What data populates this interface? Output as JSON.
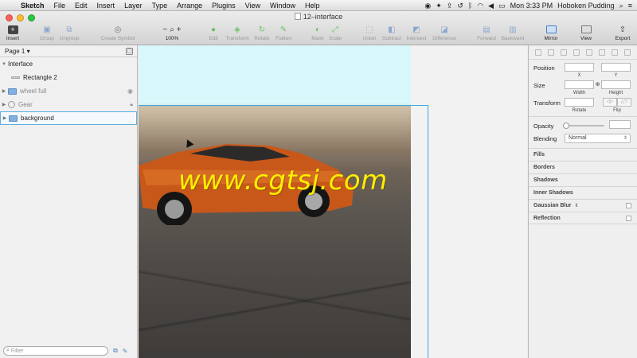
{
  "menubar": {
    "app_name": "Sketch",
    "menus": [
      "File",
      "Edit",
      "Insert",
      "Layer",
      "Type",
      "Arrange",
      "Plugins",
      "View",
      "Window",
      "Help"
    ],
    "clock": "Mon 3:33 PM",
    "user": "Hoboken Pudding"
  },
  "window": {
    "title": "12–interface"
  },
  "toolbar": {
    "insert": "Insert",
    "group": "Group",
    "ungroup": "Ungroup",
    "create_symbol": "Create Symbol",
    "zoom_minus": "−",
    "zoom_plus": "+",
    "zoom_level": "100%",
    "edit": "Edit",
    "transform": "Transform",
    "rotate": "Rotate",
    "flatten": "Flatten",
    "mask": "Mask",
    "scale": "Scale",
    "union": "Union",
    "subtract": "Subtract",
    "intersect": "Intersect",
    "difference": "Difference",
    "forward": "Forward",
    "backward": "Backward",
    "mirror": "Mirror",
    "view": "View",
    "export": "Export"
  },
  "layers": {
    "page_selector": "Page 1 ▾",
    "items": [
      {
        "label": "Interface"
      },
      {
        "label": "Rectangle 2"
      },
      {
        "label": "wheel full"
      },
      {
        "label": "Gear"
      },
      {
        "label": "background"
      }
    ],
    "filter_placeholder": "Filter"
  },
  "canvas": {
    "watermark": "www.cgtsj.com"
  },
  "inspector": {
    "position_label": "Position",
    "x_label": "X",
    "y_label": "Y",
    "size_label": "Size",
    "width_label": "Width",
    "height_label": "Height",
    "transform_label": "Transform",
    "rotate_label": "Rotate",
    "flip_label": "Flip",
    "opacity_label": "Opacity",
    "blending_label": "Blending",
    "blending_value": "Normal",
    "sections": {
      "fills": "Fills",
      "borders": "Borders",
      "shadows": "Shadows",
      "inner_shadows": "Inner Shadows",
      "gaussian_blur": "Gaussian Blur",
      "reflection": "Reflection"
    }
  },
  "colors": {
    "selection": "#38a9de",
    "artboard_bg": "#d8f8fb",
    "watermark": "#ffee00"
  }
}
